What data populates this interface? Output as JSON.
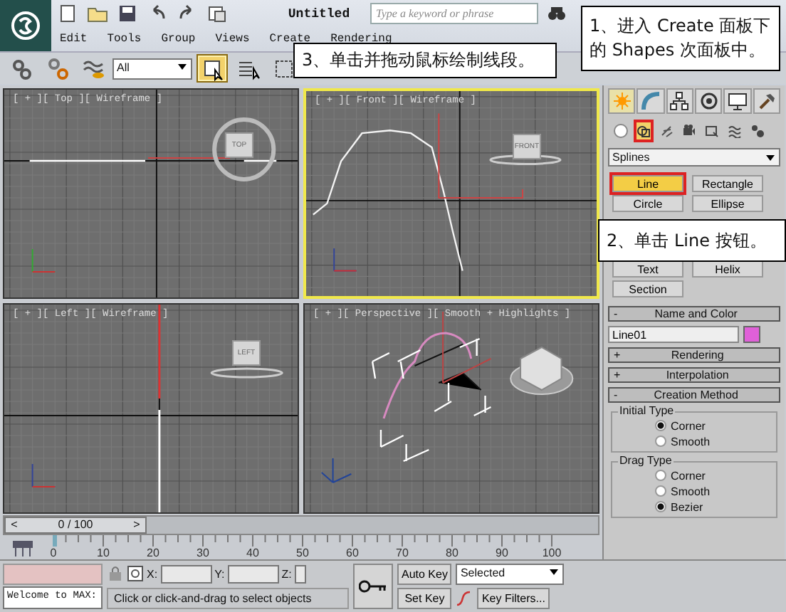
{
  "title_bar": {
    "title": "Untitled",
    "search": {
      "placeholder": "Type a keyword or phrase"
    }
  },
  "menu": [
    "Edit",
    "Tools",
    "Group",
    "Views",
    "Create",
    "Rendering"
  ],
  "toolbar": {
    "filter": "All",
    "tools": [
      {
        "kind": "link",
        "selected": false
      },
      {
        "kind": "unlink",
        "selected": false
      },
      {
        "kind": "bind",
        "selected": false
      },
      {
        "kind": "filter"
      },
      {
        "kind": "select",
        "selected": true
      },
      {
        "kind": "list",
        "selected": false
      },
      {
        "kind": "region",
        "selected": false
      }
    ]
  },
  "viewports": [
    {
      "kind": "top",
      "label": "[ + ][ Top ][ Wireframe ]",
      "active": false,
      "cube_label": "TOP"
    },
    {
      "kind": "front",
      "label": "[ + ][ Front ][ Wireframe ]",
      "active": true,
      "cube_label": "FRONT"
    },
    {
      "kind": "left",
      "label": "[ + ][ Left ][ Wireframe ]",
      "active": false,
      "cube_label": "LEFT"
    },
    {
      "kind": "perspective",
      "label": "[ + ][ Perspective ][ Smooth + Highlights ]",
      "active": false
    }
  ],
  "command_panel": {
    "tabs": [
      {
        "kind": "create",
        "selected": true
      },
      {
        "kind": "modify",
        "selected": false
      },
      {
        "kind": "hierarchy",
        "selected": false
      },
      {
        "kind": "motion",
        "selected": false
      },
      {
        "kind": "display",
        "selected": false
      },
      {
        "kind": "utilities",
        "selected": false
      }
    ],
    "categories": [
      {
        "kind": "geometry",
        "selected": false
      },
      {
        "kind": "shapes",
        "selected": true
      },
      {
        "kind": "lights",
        "selected": false
      },
      {
        "kind": "cameras",
        "selected": false
      },
      {
        "kind": "helpers",
        "selected": false
      },
      {
        "kind": "spacewarps",
        "selected": false
      },
      {
        "kind": "systems",
        "selected": false
      }
    ],
    "subcategory": "Splines",
    "object_type": [
      {
        "label": "Line",
        "selected": true
      },
      {
        "label": "Rectangle",
        "selected": false
      },
      {
        "label": "Circle",
        "selected": false
      },
      {
        "label": "Ellipse",
        "selected": false
      },
      {
        "label": "Text",
        "selected": false
      },
      {
        "label": "Helix",
        "selected": false
      },
      {
        "label": "Section",
        "selected": false
      }
    ],
    "rollouts": [
      {
        "kind": "name_color",
        "toggle": "-",
        "title": "Name and Color",
        "name": "Line01",
        "color": "#e060d8"
      },
      {
        "kind": "plain",
        "toggle": "+",
        "title": "Rendering"
      },
      {
        "kind": "plain",
        "toggle": "+",
        "title": "Interpolation"
      },
      {
        "kind": "creation",
        "toggle": "-",
        "title": "Creation Method",
        "groups": [
          {
            "title": "Initial Type",
            "options": [
              {
                "label": "Corner",
                "selected": true
              },
              {
                "label": "Smooth",
                "selected": false
              }
            ]
          },
          {
            "title": "Drag Type",
            "options": [
              {
                "label": "Corner",
                "selected": false
              },
              {
                "label": "Smooth",
                "selected": false
              },
              {
                "label": "Bezier",
                "selected": true
              }
            ]
          }
        ]
      }
    ]
  },
  "time_slider": {
    "prev": "<",
    "label": "0 / 100",
    "next": ">",
    "level": 0
  },
  "track_bar": {
    "ticks": [
      "0",
      "10",
      "20",
      "30",
      "40",
      "50",
      "60",
      "70",
      "80",
      "90",
      "100"
    ]
  },
  "status_bar": {
    "listener": "Welcome to MAX:",
    "prompt": "Click or click-and-drag to select objects",
    "coords": [
      "X:",
      "Y:",
      "Z:"
    ],
    "auto_key": "Auto Key",
    "set_key": "Set Key",
    "key_mode": "Selected",
    "key_filters": "Key Filters..."
  },
  "callouts": [
    {
      "text": "1、进入 Create 面板下的 Shapes 次面板中。"
    },
    {
      "text": "2、单击 Line 按钮。"
    },
    {
      "text": "3、单击并拖动鼠标绘制线段。"
    }
  ]
}
